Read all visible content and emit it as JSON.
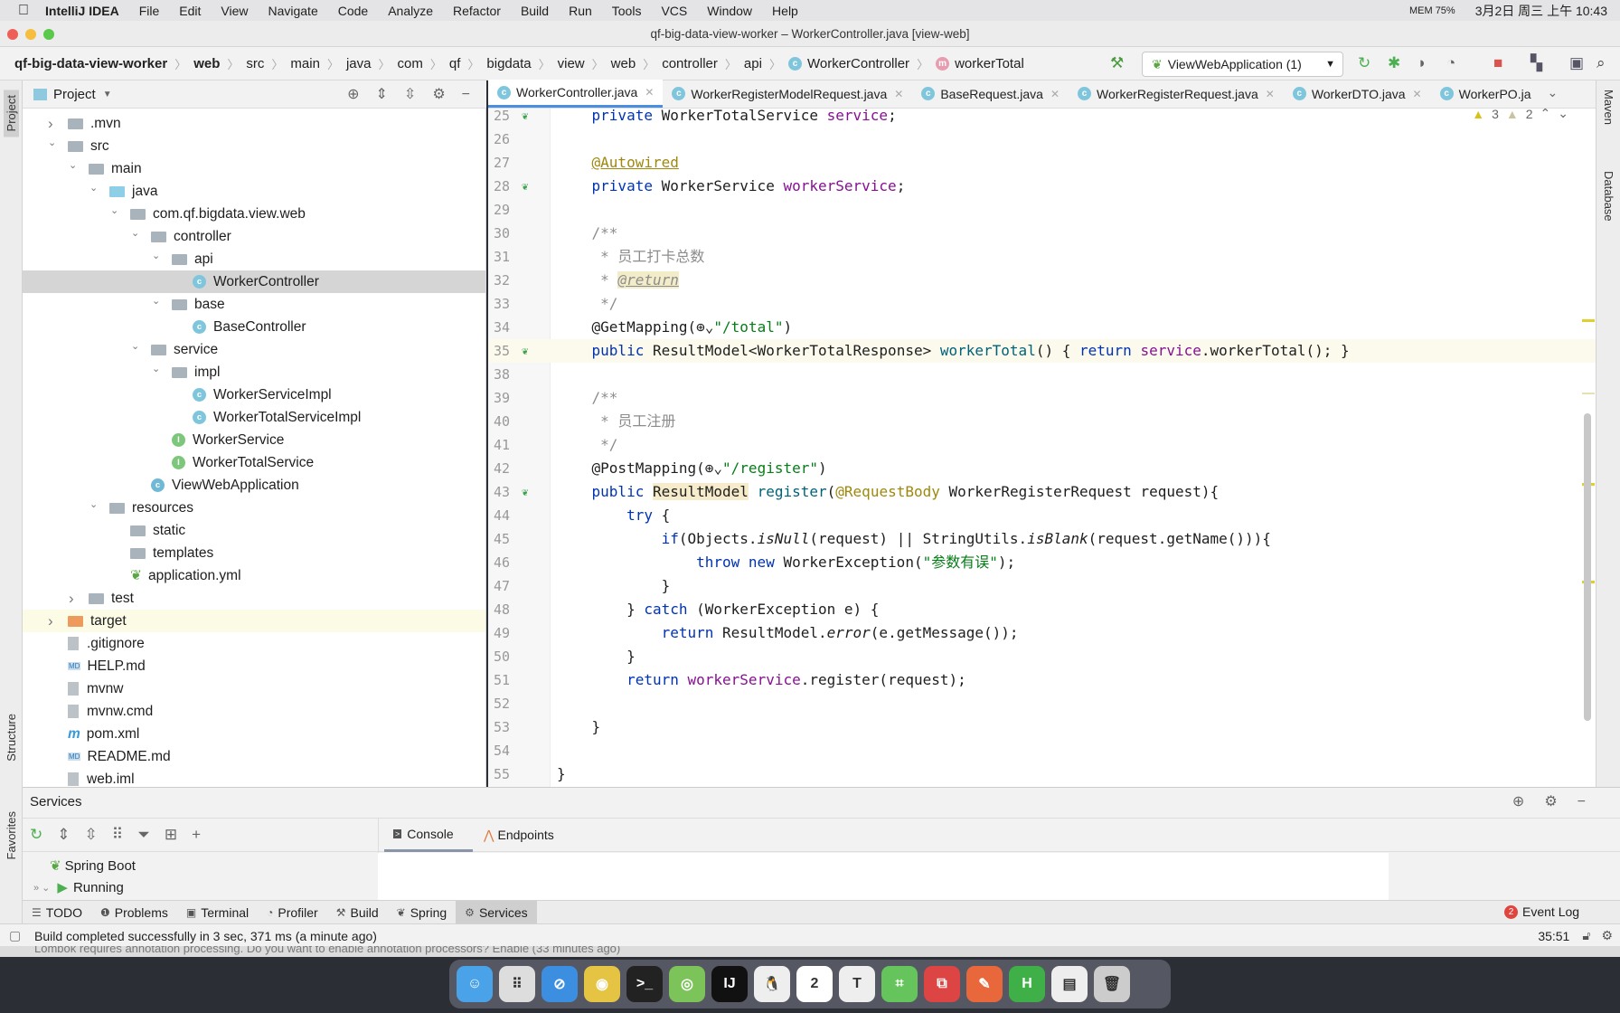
{
  "menubar": {
    "app": "IntelliJ IDEA",
    "items": [
      "File",
      "Edit",
      "View",
      "Navigate",
      "Code",
      "Analyze",
      "Refactor",
      "Build",
      "Run",
      "Tools",
      "VCS",
      "Window",
      "Help"
    ],
    "mem": "MEM 75%",
    "clock": "3月2日 周三 上午 10:43"
  },
  "window": {
    "title": "qf-big-data-view-worker – WorkerController.java [view-web]"
  },
  "breadcrumb": [
    "qf-big-data-view-worker",
    "web",
    "src",
    "main",
    "java",
    "com",
    "qf",
    "bigdata",
    "view",
    "web",
    "controller",
    "api",
    "WorkerController",
    "workerTotal"
  ],
  "run_config": "ViewWebApplication (1)",
  "project": {
    "title": "Project",
    "tree": [
      {
        "label": ".mvn",
        "depth": 0,
        "exp": "closed",
        "icon": "folder"
      },
      {
        "label": "src",
        "depth": 0,
        "exp": "open",
        "icon": "folder"
      },
      {
        "label": "main",
        "depth": 1,
        "exp": "open",
        "icon": "folder"
      },
      {
        "label": "java",
        "depth": 2,
        "exp": "open",
        "icon": "folder-src"
      },
      {
        "label": "com.qf.bigdata.view.web",
        "depth": 3,
        "exp": "open",
        "icon": "package"
      },
      {
        "label": "controller",
        "depth": 4,
        "exp": "open",
        "icon": "package"
      },
      {
        "label": "api",
        "depth": 5,
        "exp": "open",
        "icon": "package"
      },
      {
        "label": "WorkerController",
        "depth": 6,
        "icon": "class",
        "selected": true
      },
      {
        "label": "base",
        "depth": 5,
        "exp": "open",
        "icon": "package"
      },
      {
        "label": "BaseController",
        "depth": 6,
        "icon": "class"
      },
      {
        "label": "service",
        "depth": 4,
        "exp": "open",
        "icon": "package"
      },
      {
        "label": "impl",
        "depth": 5,
        "exp": "open",
        "icon": "package"
      },
      {
        "label": "WorkerServiceImpl",
        "depth": 6,
        "icon": "class"
      },
      {
        "label": "WorkerTotalServiceImpl",
        "depth": 6,
        "icon": "class"
      },
      {
        "label": "WorkerService",
        "depth": 5,
        "icon": "interface"
      },
      {
        "label": "WorkerTotalService",
        "depth": 5,
        "icon": "interface"
      },
      {
        "label": "ViewWebApplication",
        "depth": 4,
        "icon": "spring-class"
      },
      {
        "label": "resources",
        "depth": 2,
        "exp": "open",
        "icon": "folder-res"
      },
      {
        "label": "static",
        "depth": 3,
        "icon": "folder"
      },
      {
        "label": "templates",
        "depth": 3,
        "icon": "folder"
      },
      {
        "label": "application.yml",
        "depth": 3,
        "icon": "yml"
      },
      {
        "label": "test",
        "depth": 1,
        "exp": "closed",
        "icon": "folder"
      },
      {
        "label": "target",
        "depth": 0,
        "exp": "closed",
        "icon": "folder-orange",
        "highlight": true
      },
      {
        "label": ".gitignore",
        "depth": 0,
        "icon": "file"
      },
      {
        "label": "HELP.md",
        "depth": 0,
        "icon": "md"
      },
      {
        "label": "mvnw",
        "depth": 0,
        "icon": "file"
      },
      {
        "label": "mvnw.cmd",
        "depth": 0,
        "icon": "file"
      },
      {
        "label": "pom.xml",
        "depth": 0,
        "icon": "maven"
      },
      {
        "label": "README.md",
        "depth": 0,
        "icon": "md"
      },
      {
        "label": "web.iml",
        "depth": 0,
        "icon": "file"
      }
    ]
  },
  "tabs": [
    "WorkerController.java",
    "WorkerRegisterModelRequest.java",
    "BaseRequest.java",
    "WorkerRegisterRequest.java",
    "WorkerDTO.java",
    "WorkerPO.ja"
  ],
  "inspections": {
    "warnings": "3",
    "weak_warnings": "2"
  },
  "side_tools": {
    "left": [
      "Project",
      "Structure",
      "Favorites"
    ],
    "right": [
      "Maven",
      "Database"
    ]
  },
  "code": [
    {
      "n": "25",
      "g": "bean",
      "t": [
        [
          "    ",
          ""
        ],
        [
          "private ",
          "kw"
        ],
        [
          "WorkerTotalService ",
          ""
        ],
        [
          "service",
          "fld"
        ],
        [
          ";",
          ""
        ]
      ]
    },
    {
      "n": "26",
      "t": []
    },
    {
      "n": "27",
      "t": [
        [
          "    ",
          ""
        ],
        [
          "@Autowired",
          "ann ul"
        ]
      ]
    },
    {
      "n": "28",
      "g": "bean",
      "t": [
        [
          "    ",
          ""
        ],
        [
          "private ",
          "kw"
        ],
        [
          "WorkerService ",
          ""
        ],
        [
          "workerService",
          "fld"
        ],
        [
          ";",
          ""
        ]
      ]
    },
    {
      "n": "29",
      "t": []
    },
    {
      "n": "30",
      "t": [
        [
          "    /**",
          "cmt"
        ]
      ]
    },
    {
      "n": "31",
      "t": [
        [
          "     * 员工打卡总数",
          "cmt"
        ]
      ]
    },
    {
      "n": "32",
      "t": [
        [
          "     * ",
          "cmt"
        ],
        [
          "@return",
          "tag"
        ]
      ]
    },
    {
      "n": "33",
      "t": [
        [
          "     */",
          "cmt"
        ]
      ]
    },
    {
      "n": "34",
      "t": [
        [
          "    ",
          ""
        ],
        [
          "@GetMapping",
          ""
        ],
        [
          "(⊕⌄",
          ""
        ],
        [
          "\"/total\"",
          "str"
        ],
        [
          ")",
          ""
        ]
      ]
    },
    {
      "n": "35",
      "g": "web",
      "cur": true,
      "t": [
        [
          "    ",
          ""
        ],
        [
          "public ",
          "kw"
        ],
        [
          "ResultModel<WorkerTotalResponse> ",
          ""
        ],
        [
          "workerTotal",
          "mth"
        ],
        [
          "() { ",
          ""
        ],
        [
          "return ",
          "kw"
        ],
        [
          "service",
          "fld"
        ],
        [
          ".workerTotal(); }",
          ""
        ]
      ]
    },
    {
      "n": "38",
      "t": []
    },
    {
      "n": "39",
      "t": [
        [
          "    /**",
          "cmt"
        ]
      ]
    },
    {
      "n": "40",
      "t": [
        [
          "     * 员工注册",
          "cmt"
        ]
      ]
    },
    {
      "n": "41",
      "t": [
        [
          "     */",
          "cmt"
        ]
      ]
    },
    {
      "n": "42",
      "t": [
        [
          "    ",
          ""
        ],
        [
          "@PostMapping",
          ""
        ],
        [
          "(⊕⌄",
          ""
        ],
        [
          "\"/register\"",
          "str"
        ],
        [
          ")",
          ""
        ]
      ]
    },
    {
      "n": "43",
      "g": "web",
      "t": [
        [
          "    ",
          ""
        ],
        [
          "public ",
          "kw"
        ],
        [
          "ResultModel",
          "hl"
        ],
        [
          " ",
          ""
        ],
        [
          "register",
          "mth"
        ],
        [
          "(",
          ""
        ],
        [
          "@RequestBody ",
          "ann"
        ],
        [
          "WorkerRegisterRequest request){",
          ""
        ]
      ]
    },
    {
      "n": "44",
      "t": [
        [
          "        ",
          ""
        ],
        [
          "try ",
          "kw"
        ],
        [
          "{",
          ""
        ]
      ]
    },
    {
      "n": "45",
      "t": [
        [
          "            ",
          ""
        ],
        [
          "if",
          "kw"
        ],
        [
          "(Objects.",
          ""
        ],
        [
          "isNull",
          "ital"
        ],
        [
          "(request) || StringUtils.",
          ""
        ],
        [
          "isBlank",
          "ital"
        ],
        [
          "(request.getName())){",
          ""
        ]
      ]
    },
    {
      "n": "46",
      "t": [
        [
          "                ",
          ""
        ],
        [
          "throw new ",
          "kw"
        ],
        [
          "WorkerException(",
          ""
        ],
        [
          "\"参数有误\"",
          "str"
        ],
        [
          ");",
          ""
        ]
      ]
    },
    {
      "n": "47",
      "t": [
        [
          "            }",
          ""
        ]
      ]
    },
    {
      "n": "48",
      "t": [
        [
          "        } ",
          ""
        ],
        [
          "catch ",
          "kw"
        ],
        [
          "(WorkerException e) {",
          ""
        ]
      ]
    },
    {
      "n": "49",
      "t": [
        [
          "            ",
          ""
        ],
        [
          "return ",
          "kw"
        ],
        [
          "ResultModel.",
          ""
        ],
        [
          "error",
          "ital"
        ],
        [
          "(e.getMessage());",
          ""
        ]
      ]
    },
    {
      "n": "50",
      "t": [
        [
          "        }",
          ""
        ]
      ]
    },
    {
      "n": "51",
      "t": [
        [
          "        ",
          ""
        ],
        [
          "return ",
          "kw"
        ],
        [
          "workerService",
          "fld"
        ],
        [
          ".register(request);",
          ""
        ]
      ]
    },
    {
      "n": "52",
      "t": []
    },
    {
      "n": "53",
      "t": [
        [
          "    }",
          ""
        ]
      ]
    },
    {
      "n": "54",
      "t": []
    },
    {
      "n": "55",
      "t": [
        [
          "}",
          ""
        ]
      ]
    }
  ],
  "services": {
    "title": "Services",
    "tabs": [
      "Console",
      "Endpoints"
    ],
    "tree": [
      "Spring Boot",
      "Running"
    ]
  },
  "bottom_tools": [
    "TODO",
    "Problems",
    "Terminal",
    "Profiler",
    "Build",
    "Spring",
    "Services"
  ],
  "event_log": {
    "label": "Event Log",
    "count": "2"
  },
  "status": {
    "message": "Build completed successfully in 3 sec, 371 ms (a minute ago)",
    "position": "35:51",
    "hidden_notification": "Lombok requires annotation processing. Do you want to enable annotation processors? Enable (33 minutes ago)"
  },
  "colors": {
    "accent": "#4a8ee0",
    "keyword": "#0033b3",
    "field": "#871094",
    "annotation": "#9e880d",
    "string": "#067d17"
  }
}
